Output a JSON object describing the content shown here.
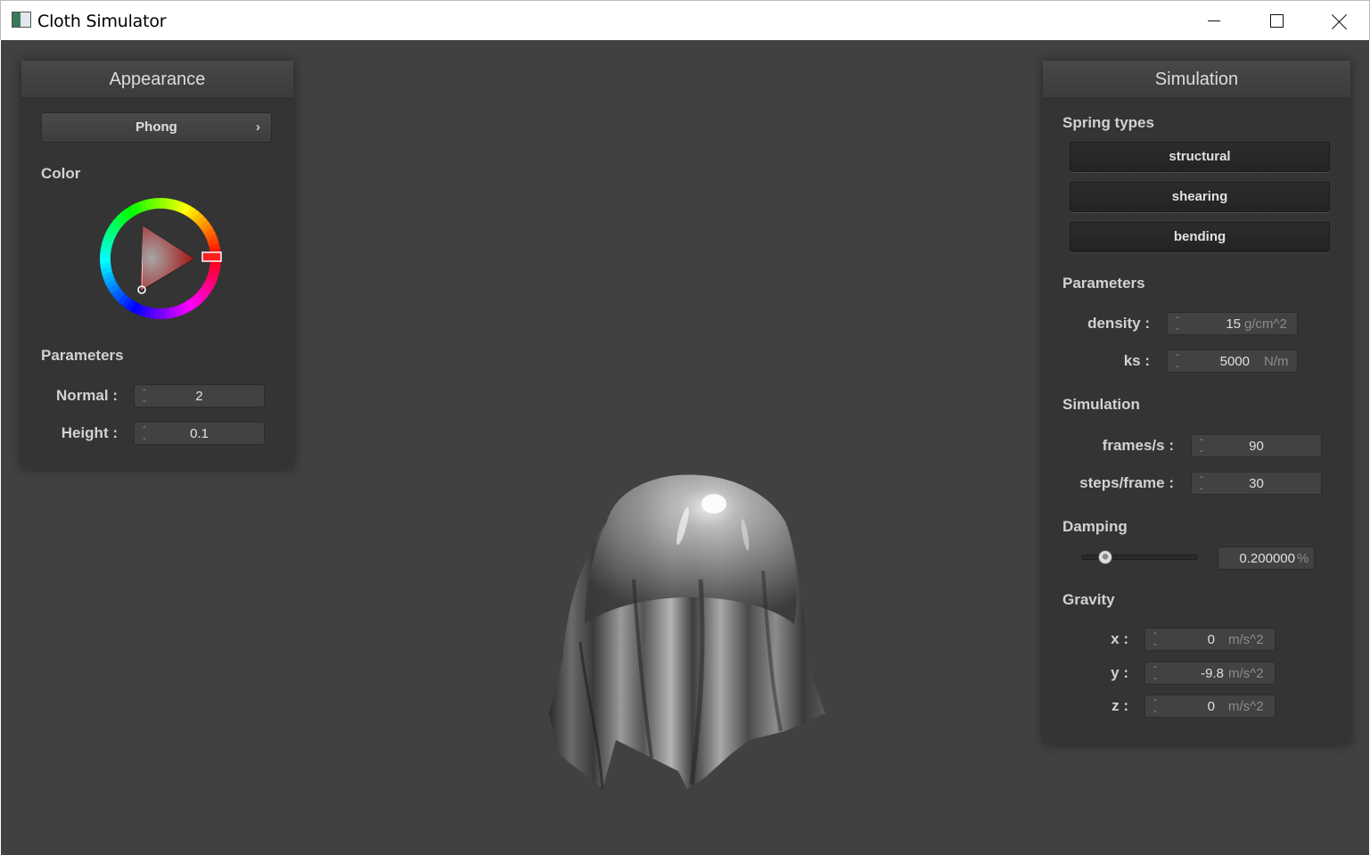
{
  "window": {
    "title": "Cloth Simulator"
  },
  "appearance": {
    "header": "Appearance",
    "shader_select": "Phong",
    "color_label": "Color",
    "params_label": "Parameters",
    "normal_label": "Normal :",
    "normal_value": "2",
    "height_label": "Height :",
    "height_value": "0.1",
    "selected_color": "#ff0000"
  },
  "simulation": {
    "header": "Simulation",
    "spring_types_label": "Spring types",
    "spring_buttons": [
      "structural",
      "shearing",
      "bending"
    ],
    "params_label": "Parameters",
    "density_label": "density :",
    "density_value": "15",
    "density_unit": "g/cm^2",
    "ks_label": "ks :",
    "ks_value": "5000",
    "ks_unit": "N/m",
    "sim_label": "Simulation",
    "fps_label": "frames/s :",
    "fps_value": "90",
    "steps_label": "steps/frame :",
    "steps_value": "30",
    "damping_label": "Damping",
    "damping_value": "0.200000",
    "damping_unit": "%",
    "damping_slider_fraction": 0.2,
    "gravity_label": "Gravity",
    "gx_label": "x :",
    "gx_value": "0",
    "gy_label": "y :",
    "gy_value": "-9.8",
    "gz_label": "z :",
    "gz_value": "0",
    "gravity_unit": "m/s^2"
  },
  "colors": {
    "viewport_bg": "#414141",
    "panel_bg": "#343434",
    "cloth": "#8a8a8a"
  },
  "icons": {
    "app": "app-window-icon",
    "minimize": "minimize-icon",
    "maximize": "maximize-icon",
    "close": "close-icon",
    "chevron": "chevron-right-icon",
    "spin": "spin-arrows-icon"
  }
}
